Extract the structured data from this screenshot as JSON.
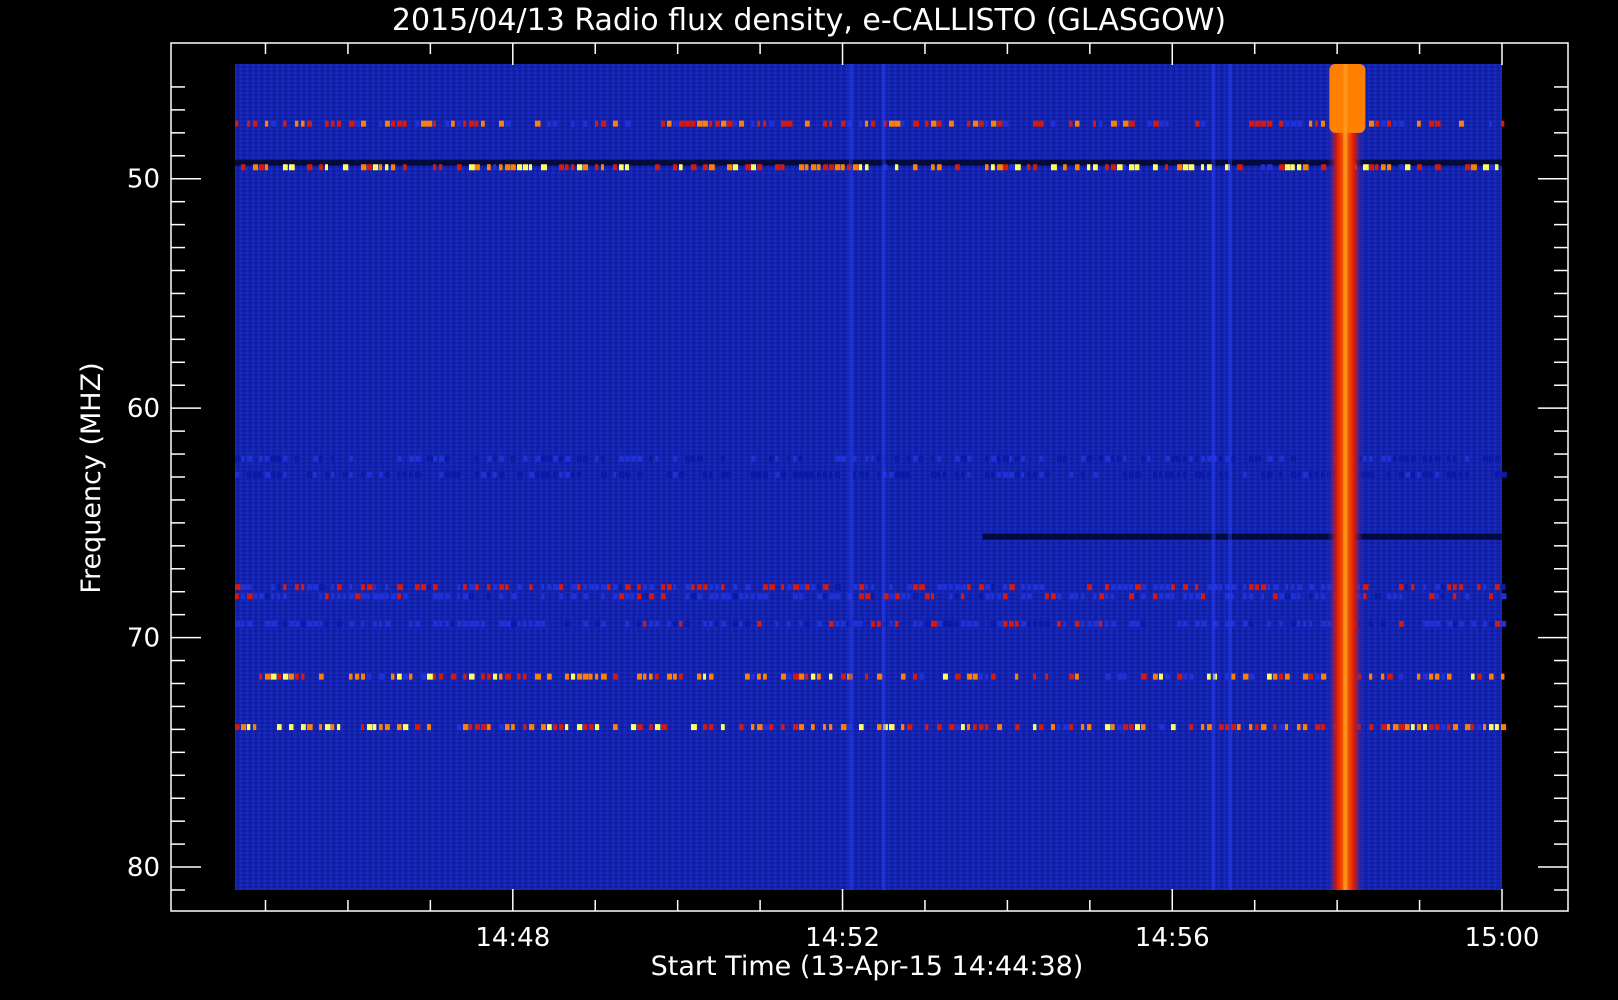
{
  "chart_data": {
    "type": "heatmap",
    "title": "2015/04/13  Radio flux density, e-CALLISTO (GLASGOW)",
    "xlabel": "Start Time (13-Apr-15 14:44:38)",
    "ylabel": "Frequency (MHZ)",
    "x_ticks": [
      "14:48",
      "14:52",
      "14:56",
      "15:00"
    ],
    "y_ticks": [
      "50",
      "60",
      "70",
      "80"
    ],
    "xlim_minutes": [
      44.63,
      60.0
    ],
    "ylim_mhz": [
      45.0,
      81.0
    ],
    "y_axis_inverted": true,
    "colormap": [
      "#000014",
      "#0a1aa8",
      "#2030d8",
      "#d81808",
      "#ff8000",
      "#ffff60"
    ],
    "background_color": "#1424b0",
    "rfi_bands": [
      {
        "freq": 47.6,
        "intensity": 0.75,
        "dashed": true
      },
      {
        "freq": 49.5,
        "intensity": 0.9,
        "dashed": true
      },
      {
        "freq": 62.2,
        "intensity": 0.35,
        "dashed": true
      },
      {
        "freq": 62.9,
        "intensity": 0.3,
        "dashed": true
      },
      {
        "freq": 67.8,
        "intensity": 0.55,
        "dashed": true
      },
      {
        "freq": 68.2,
        "intensity": 0.5,
        "dashed": true
      },
      {
        "freq": 69.4,
        "intensity": 0.45,
        "dashed": true
      },
      {
        "freq": 71.7,
        "intensity": 0.8,
        "dashed": true
      },
      {
        "freq": 73.9,
        "intensity": 0.85,
        "dashed": true
      }
    ],
    "dark_bands": [
      {
        "freq": 49.3,
        "t_start": 44.63,
        "t_end": 60.0
      },
      {
        "freq": 65.6,
        "t_start": 53.7,
        "t_end": 60.0
      }
    ],
    "burst": {
      "time": 58.1,
      "freq_start": 45.0,
      "freq_end": 81.0,
      "intensity": 1.0,
      "head_freq_range": [
        45.0,
        48.0
      ]
    },
    "faint_vertical_lines": [
      52.1,
      52.5,
      56.5,
      56.7
    ]
  }
}
